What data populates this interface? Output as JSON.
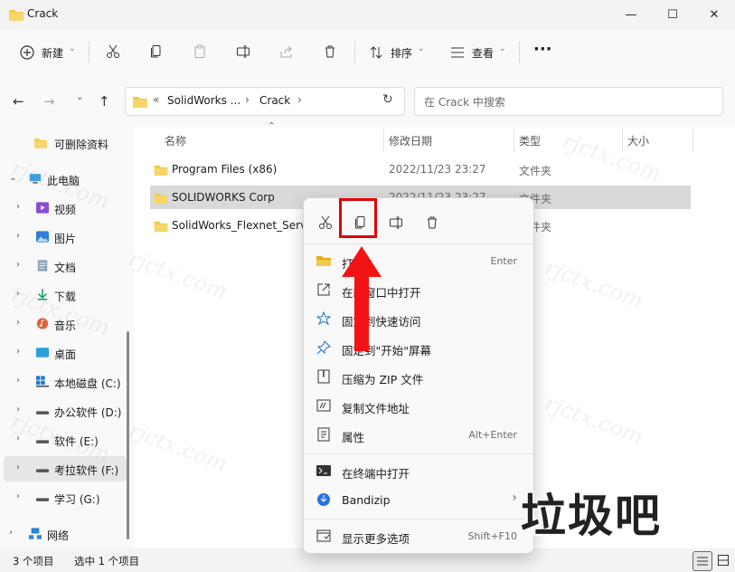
{
  "window": {
    "title": "Crack",
    "minimize_glyph": "—",
    "maximize_glyph": "☐",
    "close_glyph": "✕"
  },
  "toolbar": {
    "new_label": "新建",
    "sort_label": "排序",
    "view_label": "查看",
    "more_label": "···"
  },
  "address": {
    "prefix": "«",
    "segments": [
      "SolidWorks ...",
      "Crack"
    ],
    "separator": "›"
  },
  "search": {
    "placeholder": "在 Crack 中搜索"
  },
  "sidebar": {
    "items": [
      {
        "label": "可删除资料",
        "icon": "folder-icon"
      },
      {
        "label": "此电脑",
        "icon": "computer-icon"
      },
      {
        "label": "视频",
        "icon": "video-icon"
      },
      {
        "label": "图片",
        "icon": "picture-icon"
      },
      {
        "label": "文档",
        "icon": "document-icon"
      },
      {
        "label": "下载",
        "icon": "download-icon"
      },
      {
        "label": "音乐",
        "icon": "music-icon"
      },
      {
        "label": "桌面",
        "icon": "desktop-icon"
      },
      {
        "label": "本地磁盘 (C:)",
        "icon": "drive-icon"
      },
      {
        "label": "办公软件 (D:)",
        "icon": "drive-icon"
      },
      {
        "label": "软件 (E:)",
        "icon": "drive-icon"
      },
      {
        "label": "考拉软件 (F:)",
        "icon": "drive-icon"
      },
      {
        "label": "学习 (G:)",
        "icon": "drive-icon"
      },
      {
        "label": "网络",
        "icon": "network-icon"
      }
    ]
  },
  "columns": {
    "name": "名称",
    "date": "修改日期",
    "type": "类型",
    "size": "大小"
  },
  "files": [
    {
      "name": "Program Files (x86)",
      "date": "2022/11/23 23:27",
      "type": "文件夹"
    },
    {
      "name": "SOLIDWORKS Corp",
      "date": "2022/11/23 23:27",
      "type": "文件夹"
    },
    {
      "name": "SolidWorks_Flexnet_Serve",
      "date": "",
      "type": "文件夹"
    }
  ],
  "status": {
    "count": "3 个项目",
    "selected": "选中 1 个项目"
  },
  "context_menu": {
    "items": [
      {
        "label": "打开",
        "shortcut": "Enter"
      },
      {
        "label": "在新窗口中打开",
        "shortcut": ""
      },
      {
        "label": "固定到快速访问",
        "shortcut": ""
      },
      {
        "label": "固定到\"开始\"屏幕",
        "shortcut": ""
      },
      {
        "label": "压缩为 ZIP 文件",
        "shortcut": ""
      },
      {
        "label": "复制文件地址",
        "shortcut": ""
      },
      {
        "label": "属性",
        "shortcut": "Alt+Enter"
      },
      {
        "label": "在终端中打开",
        "shortcut": ""
      },
      {
        "label": "Bandizip",
        "shortcut": ""
      },
      {
        "label": "显示更多选项",
        "shortcut": "Shift+F10"
      }
    ],
    "submenu_glyph": "›"
  },
  "watermark": {
    "site": "rjctx.com",
    "big": "垃圾吧"
  },
  "colors": {
    "highlight_red": "#e00000",
    "folder_yellow": "#f2c94c",
    "accent_blue": "#0067c0"
  }
}
